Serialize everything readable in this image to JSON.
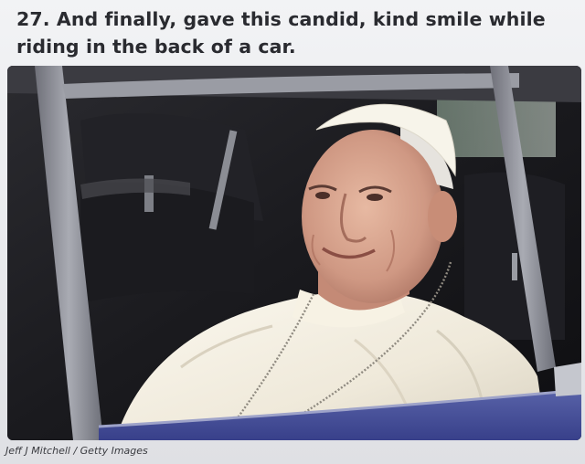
{
  "article": {
    "headline": "27. And finally, gave this candid, kind smile while riding in the back of a car.",
    "photo_credit": "Jeff J Mitchell / Getty Images"
  },
  "colors": {
    "background": "#eceef1",
    "headline_text": "#2a2b30",
    "car_frame": "#8a8d96",
    "car_body": "#4a55a0",
    "cassock": "#f3eee2",
    "zucchetto": "#f7f4ea"
  }
}
